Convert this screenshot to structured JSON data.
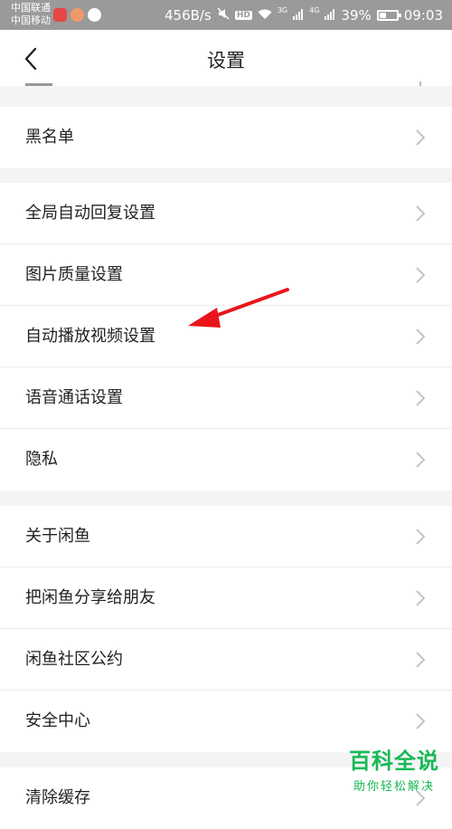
{
  "status_bar": {
    "carrier_1": "中国联通",
    "carrier_2": "中国移动",
    "net_speed": "456B/s",
    "hd_label": "HD",
    "net_3g": "3G",
    "net_4g": "4G",
    "battery_percent": "39%",
    "time": "09:03"
  },
  "header": {
    "title": "设置"
  },
  "groups": [
    {
      "items": [
        {
          "label": "黑名单"
        }
      ]
    },
    {
      "items": [
        {
          "label": "全局自动回复设置"
        },
        {
          "label": "图片质量设置"
        },
        {
          "label": "自动播放视频设置"
        },
        {
          "label": "语音通话设置"
        },
        {
          "label": "隐私"
        }
      ]
    },
    {
      "items": [
        {
          "label": "关于闲鱼"
        },
        {
          "label": "把闲鱼分享给朋友"
        },
        {
          "label": "闲鱼社区公约"
        },
        {
          "label": "安全中心"
        }
      ]
    },
    {
      "items": [
        {
          "label": "清除缓存"
        }
      ]
    }
  ],
  "watermark": {
    "main": "百科全说",
    "sub": "助你轻松解决"
  },
  "colors": {
    "accent_arrow": "#e8161b",
    "watermark": "#19b955",
    "status_bar": "#9a9a9a"
  }
}
